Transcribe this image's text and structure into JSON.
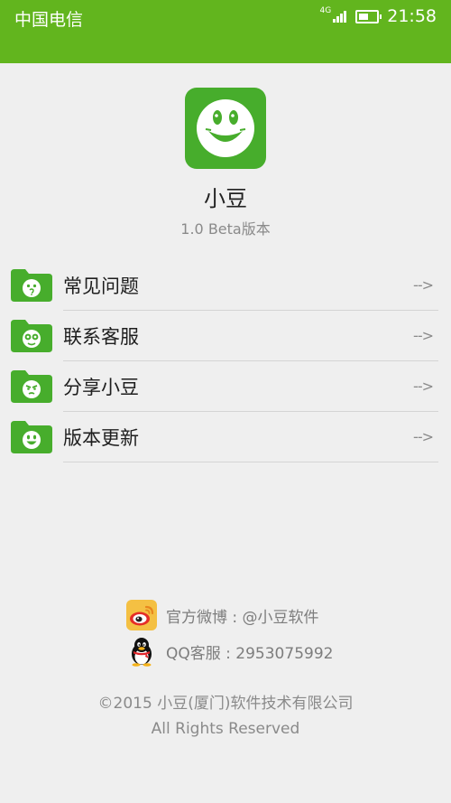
{
  "status_bar": {
    "carrier": "中国电信",
    "network": "4G",
    "time": "21:58",
    "battery_level": 0.55,
    "bg_color": "#62b51e"
  },
  "app": {
    "name": "小豆",
    "version": "1.0 Beta版本",
    "icon": "smiley-face-icon"
  },
  "menu": {
    "items": [
      {
        "label": "常见问题",
        "arrow": "-->",
        "icon": "folder-question-face-icon"
      },
      {
        "label": "联系客服",
        "arrow": "-->",
        "icon": "folder-wide-eyes-face-icon"
      },
      {
        "label": "分享小豆",
        "arrow": "-->",
        "icon": "folder-wink-face-icon"
      },
      {
        "label": "版本更新",
        "arrow": "-->",
        "icon": "folder-smile-face-icon"
      }
    ]
  },
  "contacts": {
    "weibo": {
      "text": "官方微博 : @小豆软件",
      "icon": "weibo-icon"
    },
    "qq": {
      "text": "QQ客服 : 2953075992",
      "icon": "qq-penguin-icon"
    }
  },
  "footer": {
    "copyright": "©2015 小豆(厦门)软件技术有限公司",
    "rights": "All Rights Reserved"
  },
  "colors": {
    "brand_green": "#47ad2c",
    "background": "#efefef"
  }
}
